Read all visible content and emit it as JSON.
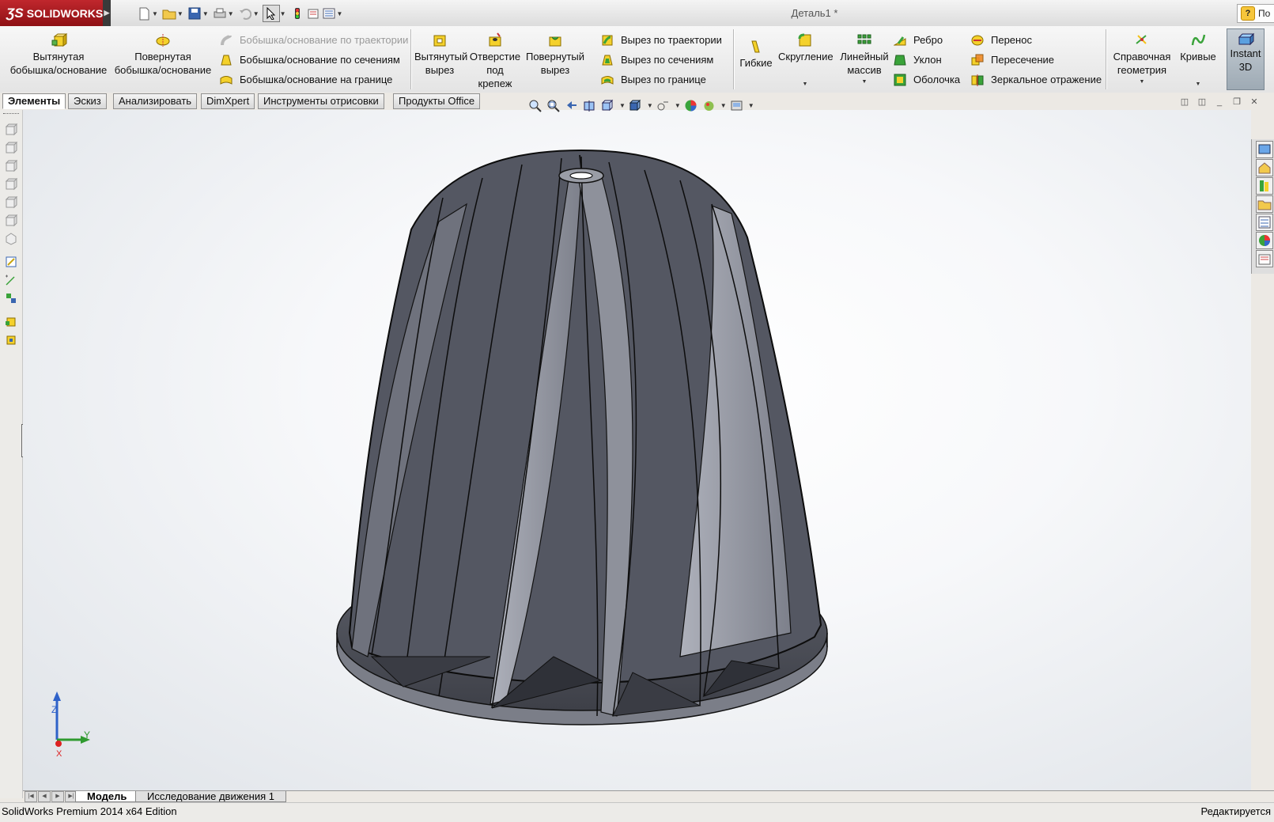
{
  "app": {
    "brand": "SOLIDWORKS",
    "document_title": "Деталь1 *",
    "help_label": "По"
  },
  "ribbon": {
    "extruded_boss": "Вытянутая\nбобышка/основание",
    "revolved_boss": "Повернутая\nбобышка/основание",
    "swept_boss": "Бобышка/основание по траектории",
    "lofted_boss": "Бобышка/основание по сечениям",
    "boundary_boss": "Бобышка/основание на границе",
    "extruded_cut": "Вытянутый\nвырез",
    "hole_wizard": "Отверстие\nпод\nкрепеж",
    "revolved_cut": "Повернутый\nвырез",
    "swept_cut": "Вырез по траектории",
    "lofted_cut": "Вырез по сечениям",
    "boundary_cut": "Вырез по границе",
    "flex": "Гибкие",
    "fillet": "Скругление",
    "linear_pattern": "Линейный\nмассив",
    "rib": "Ребро",
    "draft": "Уклон",
    "shell": "Оболочка",
    "wrap": "Перенос",
    "intersect": "Пересечение",
    "mirror": "Зеркальное отражение",
    "reference_geometry": "Справочная\nгеометрия",
    "curves": "Кривые",
    "instant3d": "Instant\n3D"
  },
  "tabs": [
    "Элементы",
    "Эскиз",
    "Анализировать",
    "DimXpert",
    "Инструменты отрисовки",
    "Продукты Office"
  ],
  "bottom_tabs": [
    "Модель",
    "Исследование движения 1"
  ],
  "triad": {
    "z": "Z",
    "y": "Y",
    "x": "X"
  },
  "status": {
    "left": "SolidWorks Premium 2014 x64 Edition",
    "right": "Редактируется"
  },
  "colors": {
    "brand_red": "#b31b20",
    "model_dark": "#4a4d57",
    "model_light": "#8d909b",
    "viewport_bg": "#f3f5f8"
  }
}
